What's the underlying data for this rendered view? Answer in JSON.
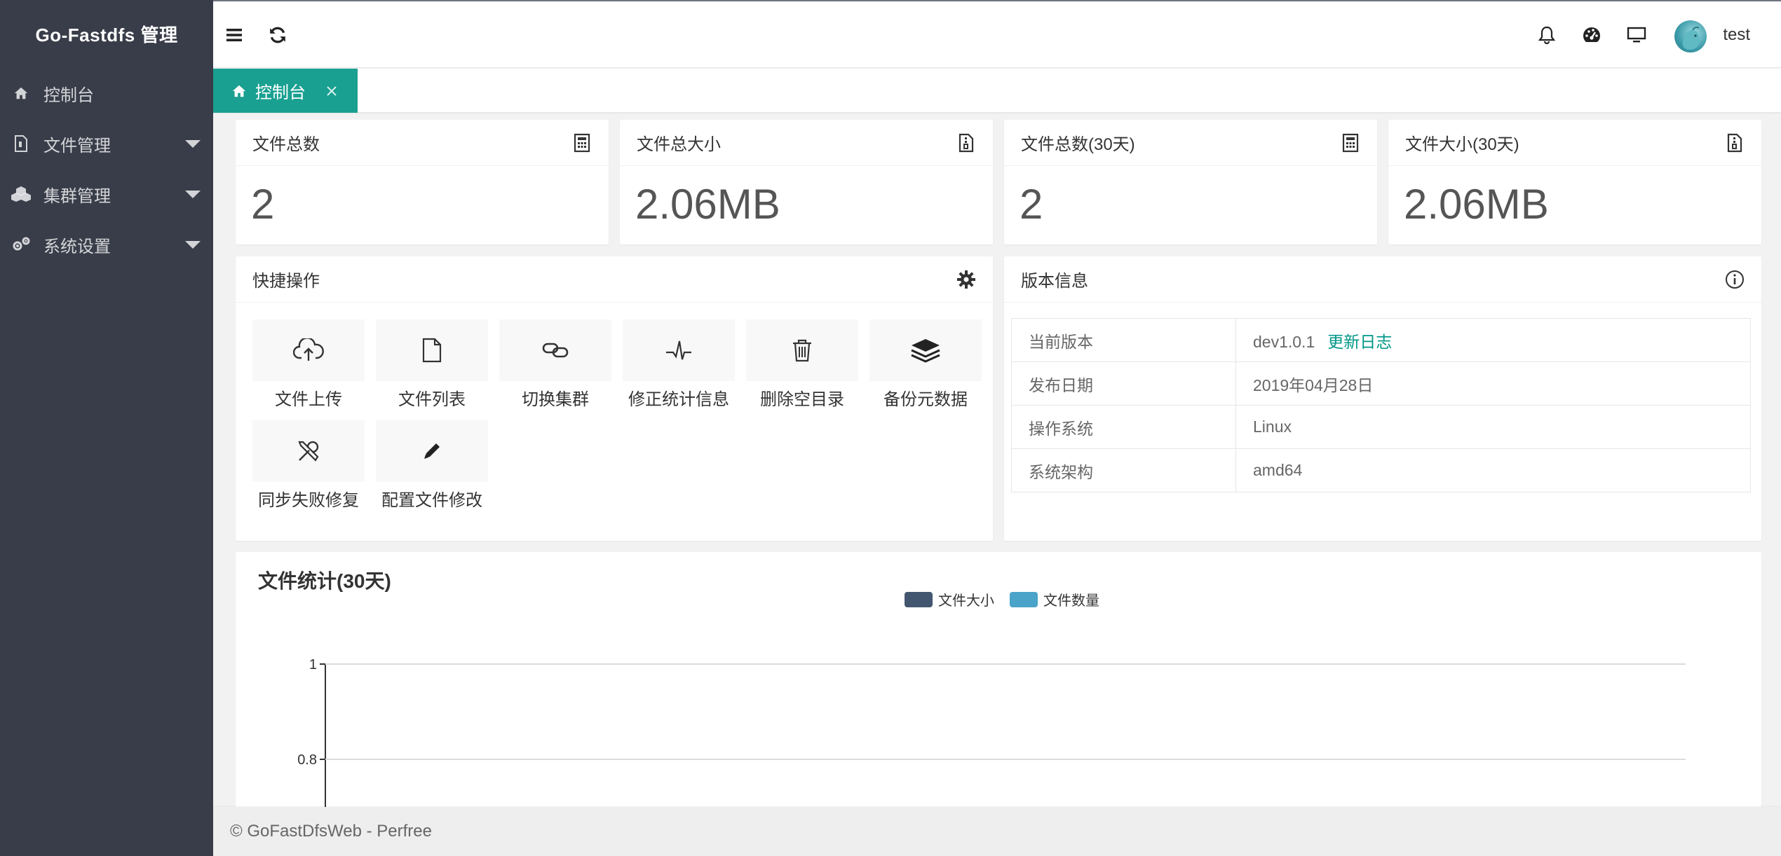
{
  "app": {
    "title": "Go-Fastdfs 管理"
  },
  "sidebar": {
    "items": [
      {
        "label": "控制台",
        "icon": "home-icon",
        "has_submenu": false
      },
      {
        "label": "文件管理",
        "icon": "file-icon",
        "has_submenu": true
      },
      {
        "label": "集群管理",
        "icon": "cubes-icon",
        "has_submenu": true
      },
      {
        "label": "系统设置",
        "icon": "gears-icon",
        "has_submenu": true
      }
    ]
  },
  "header": {
    "user_name": "test",
    "icons": [
      "menu-icon",
      "refresh-icon",
      "bell-icon",
      "dashboard-icon",
      "monitor-icon"
    ]
  },
  "tabs": [
    {
      "label": "控制台",
      "icon": "home-icon",
      "active": true
    }
  ],
  "stats": [
    {
      "title": "文件总数",
      "value": "2",
      "icon": "calculator-icon"
    },
    {
      "title": "文件总大小",
      "value": "2.06MB",
      "icon": "file-archive-icon"
    },
    {
      "title": "文件总数(30天)",
      "value": "2",
      "icon": "calculator-icon"
    },
    {
      "title": "文件大小(30天)",
      "value": "2.06MB",
      "icon": "file-archive-icon"
    }
  ],
  "quick_actions": {
    "title": "快捷操作",
    "items": [
      {
        "label": "文件上传",
        "icon": "cloud-upload-icon"
      },
      {
        "label": "文件列表",
        "icon": "file-icon"
      },
      {
        "label": "切换集群",
        "icon": "link-icon"
      },
      {
        "label": "修正统计信息",
        "icon": "pulse-icon"
      },
      {
        "label": "删除空目录",
        "icon": "trash-icon"
      },
      {
        "label": "备份元数据",
        "icon": "layers-icon"
      },
      {
        "label": "同步失败修复",
        "icon": "tools-icon"
      },
      {
        "label": "配置文件修改",
        "icon": "pencil-icon"
      }
    ]
  },
  "version": {
    "title": "版本信息",
    "rows": [
      {
        "key": "当前版本",
        "value": "dev1.0.1",
        "link": "更新日志"
      },
      {
        "key": "发布日期",
        "value": "2019年04月28日"
      },
      {
        "key": "操作系统",
        "value": "Linux"
      },
      {
        "key": "系统架构",
        "value": "amd64"
      }
    ]
  },
  "chart": {
    "title": "文件统计(30天)"
  },
  "chart_data": {
    "type": "line",
    "title": "",
    "legend": [
      {
        "name": "文件大小",
        "color": "#435670"
      },
      {
        "name": "文件数量",
        "color": "#4aa3c9"
      }
    ],
    "legend_position": "top-center",
    "y_ticks": [
      "1",
      "0.8"
    ],
    "ylim": [
      0,
      1
    ],
    "grid": true,
    "series": [
      {
        "name": "文件大小",
        "values": []
      },
      {
        "name": "文件数量",
        "values": []
      }
    ]
  },
  "footer": {
    "text": "© GoFastDfsWeb - Perfree"
  },
  "colors": {
    "sidebar": "#393d49",
    "accent": "#009688",
    "tab_active": "#19a091"
  }
}
